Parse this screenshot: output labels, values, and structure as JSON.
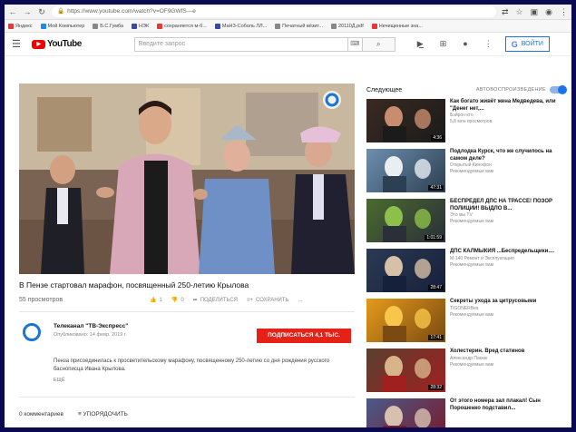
{
  "browser": {
    "url": "https://www.youtube.com/watch?v=OF9GWfS—e",
    "bookmarks": [
      {
        "label": "Яндекс",
        "color": "#e53935"
      },
      {
        "label": "Мой Компьютер",
        "color": "#1e88e5"
      },
      {
        "label": "Б.С.Гумба",
        "color": "#888888"
      },
      {
        "label": "НЭК",
        "color": "#3949ab"
      },
      {
        "label": "сохраняется м-б...",
        "color": "#e53935"
      },
      {
        "label": "МаНЗ-Соболь ЛЛ...",
        "color": "#3949ab"
      },
      {
        "label": "Печатный вёзит...",
        "color": "#888888"
      },
      {
        "label": "20110Д.pdf",
        "color": "#888888"
      },
      {
        "label": "Нечищенные зна...",
        "color": "#e53935"
      }
    ]
  },
  "header": {
    "logo_text": "YouTube",
    "search_placeholder": "Введите запрос",
    "login_label": "ВОЙТИ"
  },
  "video": {
    "title": "В Пензе стартовал марафон, посвященный 250-летию Крылова",
    "views": "55 просмотров",
    "likes": "1",
    "dislikes": "0",
    "share_label": "ПОДЕЛИТЬСЯ",
    "save_label": "СОХРАНИТЬ",
    "more_label": "...",
    "channel_name": "Телеканал \"ТВ-Экспресс\"",
    "published": "Опубликовано: 14 февр. 2019 г.",
    "subscribe_label": "ПОДПИСАТЬСЯ 4,1 ТЫС.",
    "description": "Пенза присоединилась к просветительскому марафону, посвященному 250-летию со дня рождения русского баснописца Ивана Крылова.",
    "more_desc": "ЕЩЁ",
    "comments_count": "0 комментариев",
    "sort_label": "УПОРЯДОЧИТЬ"
  },
  "sidebar": {
    "next_label": "Следующее",
    "autoplay_label": "АВТОВОСПРОИЗВЕДЕНИЕ",
    "items": [
      {
        "title": "Как богато живёт жена Медведева, или \"Денег нет,...",
        "channel": "Бэйрон кто",
        "meta": "5,8 млн просмотров",
        "duration": "4:36"
      },
      {
        "title": "Подлодка Курск, что же случилось на самом деле?",
        "channel": "Открытый Кинофон",
        "meta": "Рекомендуемые вам",
        "duration": "47:31"
      },
      {
        "title": "БЕСПРЕДЕЛ ДПС НА ТРАССЕ! ПОЗОР ПОЛИЦИИ! ВЫДЛО В...",
        "channel": "Это мы TV",
        "meta": "Рекомендуемые вам",
        "duration": "1:01:59"
      },
      {
        "title": "ДПС КАЛМЫКИЯ ...Беспредельщики....",
        "channel": "М-140 Ремонт и Эксплуатация",
        "meta": "Рекомендуемые вам",
        "duration": "28:47"
      },
      {
        "title": "Секреты ухода за цитрусовыми",
        "channel": "TIGONERBes",
        "meta": "Рекомендуемые вам",
        "duration": "17:41"
      },
      {
        "title": "Холестерин. Вред статинов",
        "channel": "Александр Пасюк",
        "meta": "Рекомендуемые вам",
        "duration": "28:32"
      },
      {
        "title": "От этого номера зал плакал! Сын Порошенко подставил...",
        "channel": "",
        "meta": "",
        "duration": ""
      }
    ]
  }
}
